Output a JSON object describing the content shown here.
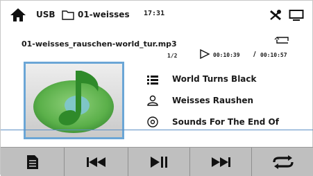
{
  "header": {
    "source": "USB",
    "folder": "01-weisses",
    "clock": "17:31",
    "icons": [
      "home-icon",
      "folder-icon",
      "tools-icon",
      "screen-icon"
    ]
  },
  "track": {
    "file_name": "01-weisses_rauschen-world_tur.mp3",
    "index": "1/2",
    "elapsed": "00:10:39",
    "separator": "/",
    "total": "00:10:57",
    "title": "World Turns Black",
    "artist": "Weisses Raushen",
    "album": "Sounds For The End Of"
  },
  "controls": {
    "buttons": [
      "playlist",
      "previous",
      "play-pause",
      "next",
      "repeat"
    ]
  },
  "colors": {
    "accent": "#6ba6d6",
    "bar": "#bfbfbf",
    "note": "#3a8a2e"
  }
}
